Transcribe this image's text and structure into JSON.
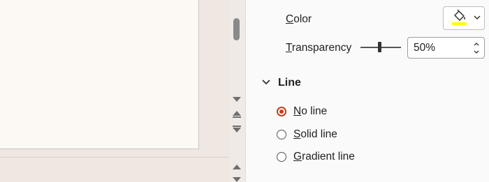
{
  "colors": {
    "accent": "#c43e1c",
    "fill_swatch": "#ffff00"
  },
  "fill": {
    "color_label": "Color",
    "color_underline_letter": "C",
    "color_rest": "olor",
    "color_button_icon": "paint-bucket-icon",
    "transparency_underline_letter": "T",
    "transparency_rest": "ransparency",
    "transparency_value": "50%",
    "transparency_fraction": 0.5
  },
  "line": {
    "section_title": "Line",
    "options": [
      {
        "underline": "N",
        "rest": "o line",
        "checked": true
      },
      {
        "underline": "S",
        "rest": "olid line",
        "checked": false
      },
      {
        "underline": "G",
        "rest": "radient line",
        "checked": false
      }
    ]
  }
}
